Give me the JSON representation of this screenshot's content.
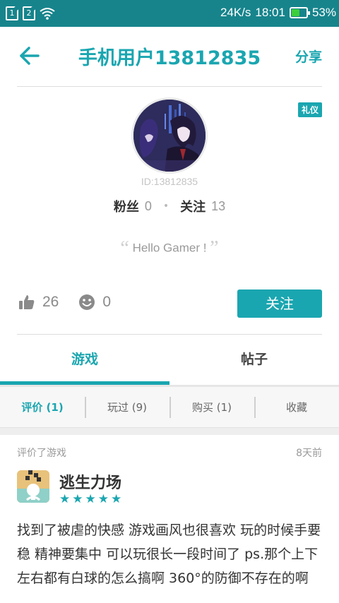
{
  "status_bar": {
    "sim1": "1",
    "sim2": "2",
    "speed": "24K/s",
    "time": "18:01",
    "battery": "53%",
    "battery_level": 0.53,
    "battery_color": "#3ccf3c"
  },
  "header": {
    "title": "手机用户13812835",
    "share_label": "分享"
  },
  "profile": {
    "badge": "礼仪",
    "user_id": "ID:13812835",
    "fans_label": "粉丝",
    "fans_count": "0",
    "following_label": "关注",
    "following_count": "13",
    "bio": "Hello Gamer !"
  },
  "stats": {
    "likes": "26",
    "emoji_count": "0",
    "follow_button": "关注"
  },
  "tabs": [
    {
      "label": "游戏",
      "active": true
    },
    {
      "label": "帖子",
      "active": false
    }
  ],
  "subtabs": [
    {
      "label": "评价 (1)",
      "active": true
    },
    {
      "label": "玩过 (9)",
      "active": false
    },
    {
      "label": "购买 (1)",
      "active": false
    },
    {
      "label": "收藏",
      "active": false
    }
  ],
  "feed": {
    "action": "评价了游戏",
    "time": "8天前",
    "game_name": "逃生力场",
    "rating": 5,
    "review": "找到了被虐的快感 游戏画风也很喜欢 玩的时候手要稳 精神要集中 可以玩很长一段时间了 ps.那个上下左右都有白球的怎么搞啊 360°的防御不存在的啊"
  },
  "colors": {
    "accent": "#1aa6b0",
    "status_bar": "#17848c"
  }
}
